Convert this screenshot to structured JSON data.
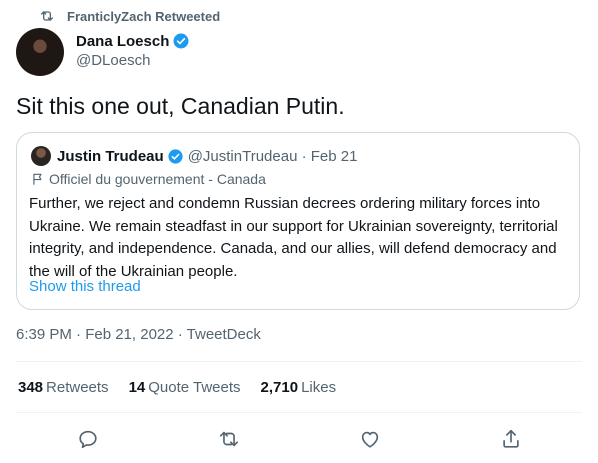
{
  "retweet_bar": {
    "text": "FranticlyZach Retweeted"
  },
  "author": {
    "name": "Dana Loesch",
    "handle": "@DLoesch"
  },
  "tweet": {
    "text": "Sit this one out, Canadian Putin."
  },
  "quoted": {
    "name": "Justin Trudeau",
    "meta": "@JustinTrudeau · Feb 21",
    "label": "Officiel du gouvernement - Canada",
    "body_lines": [
      "Further, we reject and condemn Russian decrees ordering military forces into",
      "Ukraine. We remain steadfast in our support for Ukrainian sovereignty, territorial",
      "integrity, and independence. Canada, and our allies, will defend democracy and",
      "the will of the Ukrainian people."
    ],
    "show_thread": "Show this thread"
  },
  "timestamp": "6:39 PM · Feb 21, 2022 · TweetDeck",
  "stats": {
    "retweets": {
      "count": "348",
      "label": "Retweets"
    },
    "quote_tweets": {
      "count": "14",
      "label": "Quote Tweets"
    },
    "likes": {
      "count": "2,710",
      "label": "Likes"
    }
  },
  "actions": [
    "reply-icon",
    "retweet-icon",
    "like-icon",
    "share-icon"
  ],
  "colors": {
    "link": "#1d9bf0",
    "muted": "#536471",
    "text": "#0f1419",
    "border": "#cfd9de"
  }
}
